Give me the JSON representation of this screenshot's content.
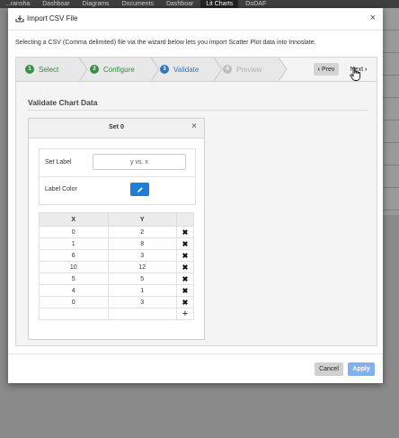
{
  "background": {
    "tabs": [
      "...ransha",
      "Dashboar",
      "Diagrams",
      "Documents",
      "Dashboar",
      "Lit Charts",
      "DoDAF"
    ],
    "active_tab_index": 5
  },
  "dialog": {
    "title": "Import CSV File",
    "close_glyph": "×",
    "intro": "Selecting a CSV (Comma delimited) file via the wizard below lets you import Scatter Plot data into Innoslate."
  },
  "wizard": {
    "steps": [
      {
        "num": "1",
        "label": "Select",
        "state": "done"
      },
      {
        "num": "2",
        "label": "Configure",
        "state": "done"
      },
      {
        "num": "3",
        "label": "Validate",
        "state": "active"
      },
      {
        "num": "4",
        "label": "Preview",
        "state": "disabled"
      }
    ],
    "prev_label": "Prev",
    "next_label": "Next"
  },
  "section_title": "Validate Chart Data",
  "set": {
    "title": "Set 0",
    "close_glyph": "×",
    "label_caption": "Set Label",
    "label_value": "y vs. x",
    "color_caption": "Label Color",
    "color": "#1f7ed6",
    "columns": [
      "X",
      "Y"
    ],
    "rows": [
      {
        "x": "0",
        "y": "2"
      },
      {
        "x": "1",
        "y": "8"
      },
      {
        "x": "6",
        "y": "3"
      },
      {
        "x": "10",
        "y": "12"
      },
      {
        "x": "5",
        "y": "5"
      },
      {
        "x": "4",
        "y": "1"
      },
      {
        "x": "0",
        "y": "3"
      }
    ],
    "delete_glyph": "✖",
    "add_glyph": "+"
  },
  "footer": {
    "cancel_label": "Cancel",
    "apply_label": "Apply"
  },
  "colors": {
    "done": "#3a8f47",
    "active": "#2e78b8",
    "apply": "#7fb0ef"
  }
}
